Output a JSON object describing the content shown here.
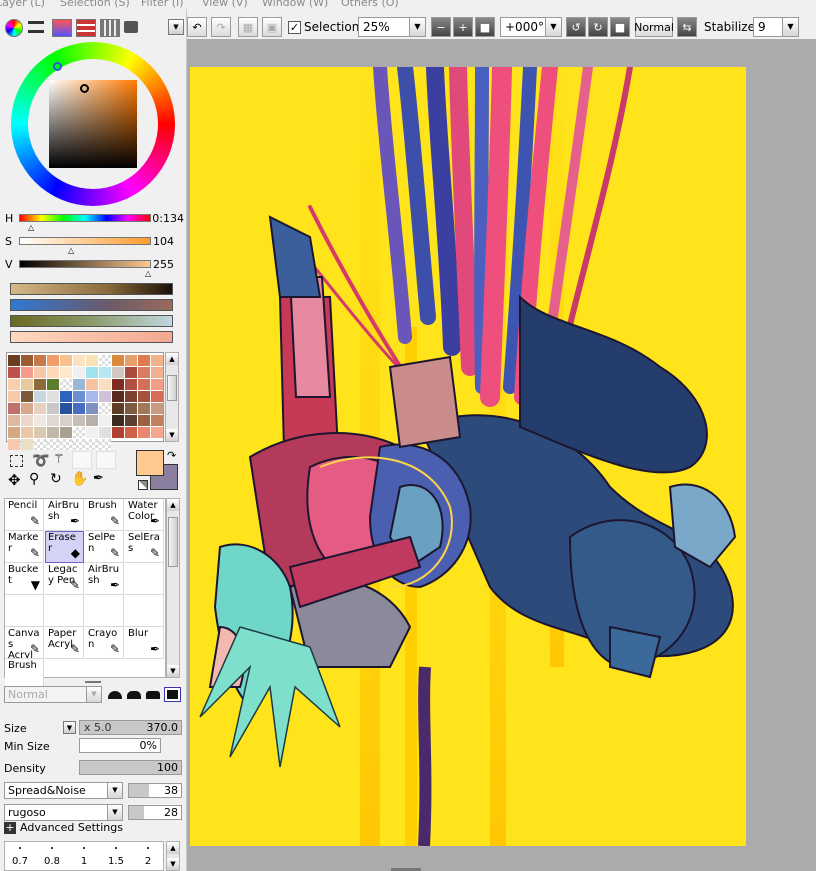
{
  "menu": [
    "Layer (L)",
    "Selection (S)",
    "Filter (I)",
    "View (V)",
    "Window (W)",
    "Others (O)"
  ],
  "toolbar": {
    "selection_label": "Selection",
    "selection_checked": true,
    "zoom": "25%",
    "rotation": "+000°",
    "blend_mode": "Normal",
    "stabilizer_label": "Stabilizer",
    "stabilizer_value": "9"
  },
  "color": {
    "current_hex": "#ffc98f",
    "secondary_hex": "#8a7f9e",
    "h_label": "H",
    "h_value": "0:134",
    "s_label": "S",
    "s_value": "104",
    "v_label": "V",
    "v_value": "255"
  },
  "swatch_colors": [
    "#6b3d20",
    "#9a5a33",
    "#c67a4a",
    "#ee9d6b",
    "#f6c08f",
    "#fde2c2",
    "#f7e4b6",
    "#ffffff",
    "#d98a3c",
    "#e8a06a",
    "#e07a50",
    "#f3b38a",
    "#c0504a",
    "#f59b8b",
    "#f7c6a6",
    "#fbd9b8",
    "#fde8cc",
    "#f0f0f0",
    "#9fe3ee",
    "#b8e7f3",
    "#d0c8c0",
    "#a94b3f",
    "#d87c62",
    "#f0b090",
    "#f8d0b0",
    "#e6c9a0",
    "#8a6b3c",
    "#5a7d2e",
    "#ffffff",
    "#9bb7d8",
    "#f7c29f",
    "#fbdcc0",
    "#7e2c24",
    "#b25040",
    "#d46f5a",
    "#f29e87",
    "#fac9a8",
    "#7a5a38",
    "#c8d8e0",
    "#e0e0e0",
    "#2e63c0",
    "#6b8fd0",
    "#a8b8e8",
    "#d0c0d8",
    "#5a2a20",
    "#804030",
    "#a65040",
    "#d66c58",
    "#c0706a",
    "#d8a88c",
    "#e8d0c0",
    "#c8c8c8",
    "#2850a0",
    "#4a6cc0",
    "#8090c0",
    "#ffffff",
    "#5e3c28",
    "#7e5a40",
    "#a07a58",
    "#c89a80",
    "#e0b8a0",
    "#ead8c8",
    "#f0e8e0",
    "#e0d8d0",
    "#d8d0c8",
    "#c8c0b8",
    "#b8b0a8",
    "#f0f0f0",
    "#3a2a20",
    "#5a4030",
    "#9a6040",
    "#c08060",
    "#d4a880",
    "#e8c8a8",
    "#d8c8b0",
    "#c0b8a8",
    "#a8a090",
    "#ffffff",
    "#f0f0f0",
    "#e0e0e0",
    "#b04030",
    "#d06048",
    "#e88870",
    "#f4a890",
    "#f8c8b0",
    "#e8e0c0",
    "#ffffff",
    "#ffffff",
    "#ffffff",
    "#ffffff",
    "#ffffff",
    "#ffffff"
  ],
  "tools": [
    {
      "name": "Pencil",
      "icon": "pencil-icon",
      "glyph": "✎",
      "selected": false
    },
    {
      "name": "AirBrush",
      "icon": "airbrush-icon",
      "glyph": "✒",
      "selected": false
    },
    {
      "name": "Brush",
      "icon": "brush-icon",
      "glyph": "✎",
      "selected": false
    },
    {
      "name": "Water Color",
      "icon": "watercolor-icon",
      "glyph": "✒",
      "selected": false
    },
    {
      "name": "Marker",
      "icon": "marker-icon",
      "glyph": "✎",
      "selected": false
    },
    {
      "name": "Eraser",
      "icon": "eraser-icon",
      "glyph": "◆",
      "selected": true
    },
    {
      "name": "SelPen",
      "icon": "selpen-icon",
      "glyph": "✎",
      "selected": false
    },
    {
      "name": "SelEras",
      "icon": "seleras-icon",
      "glyph": "✎",
      "selected": false
    },
    {
      "name": "Bucket",
      "icon": "bucket-icon",
      "glyph": "▼",
      "selected": false
    },
    {
      "name": "Legacy Pen",
      "icon": "legacy-pen-icon",
      "glyph": "✎",
      "selected": false
    },
    {
      "name": "AirBrush",
      "icon": "airbrush-icon",
      "glyph": "✒",
      "selected": false
    },
    {
      "name": "",
      "icon": "",
      "glyph": "",
      "selected": false
    },
    {
      "name": "",
      "icon": "",
      "glyph": "",
      "selected": false
    },
    {
      "name": "",
      "icon": "",
      "glyph": "",
      "selected": false
    },
    {
      "name": "",
      "icon": "",
      "glyph": "",
      "selected": false
    },
    {
      "name": "",
      "icon": "",
      "glyph": "",
      "selected": false
    },
    {
      "name": "Canvas Acryl",
      "icon": "canvas-acryl-icon",
      "glyph": "✎",
      "selected": false
    },
    {
      "name": "Paper Acryl",
      "icon": "paper-acryl-icon",
      "glyph": "✎",
      "selected": false
    },
    {
      "name": "Crayon",
      "icon": "crayon-icon",
      "glyph": "✎",
      "selected": false
    },
    {
      "name": "Blur",
      "icon": "blur-icon",
      "glyph": "✒",
      "selected": false
    },
    {
      "name": "Brush",
      "icon": "brush-icon",
      "glyph": "",
      "selected": false
    }
  ],
  "tool_settings": {
    "blend": "Normal",
    "size_label": "Size",
    "size_mult": "x 5.0",
    "size_value": "370.0",
    "min_size_label": "Min Size",
    "min_size_value": "0%",
    "density_label": "Density",
    "density_value": "100",
    "texture1": "Spread&Noise",
    "texture1_value": "38",
    "texture2": "rugoso",
    "texture2_value": "28",
    "advanced_label": "Advanced Settings",
    "brush_sizes": [
      "0.7",
      "0.8",
      "1",
      "1.5",
      "2"
    ]
  }
}
